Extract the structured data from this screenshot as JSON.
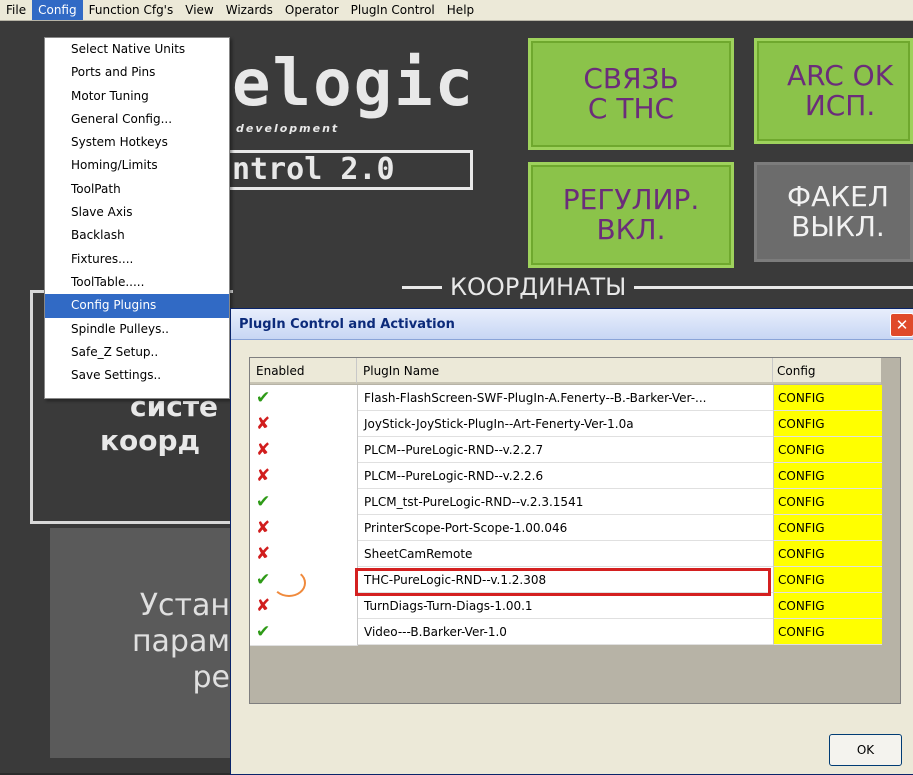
{
  "menubar": {
    "items": [
      "File",
      "Config",
      "Function Cfg's",
      "View",
      "Wizards",
      "Operator",
      "PlugIn Control",
      "Help"
    ]
  },
  "config_menu": {
    "items": [
      "Select Native Units",
      "Ports and Pins",
      "Motor Tuning",
      "General Config...",
      "System Hotkeys",
      "Homing/Limits",
      "ToolPath",
      "Slave Axis",
      "Backlash",
      "Fixtures....",
      "ToolTable.....",
      "Config Plugins",
      "Spindle Pulleys..",
      "Safe_Z Setup..",
      "Save Settings.."
    ],
    "selected": "Config Plugins"
  },
  "background": {
    "logo_text": "elogic",
    "logo_subtext": "development",
    "logo_control": "ntrol 2.0",
    "btn_thc_link": "СВЯЗЬ\nС ТНС",
    "btn_arc_ok": "ARC OK\nИСП.",
    "btn_reg_on": "РЕГУЛИР.\nВКЛ.",
    "btn_torch_off": "ФАКЕЛ\nВЫКЛ.",
    "coords_title": "КООРДИНАТЫ",
    "sys_line1": "систе",
    "sys_line2": "коорд",
    "panel_text": "Устан\nпарам\nре"
  },
  "dialog": {
    "title": "PlugIn Control and Activation",
    "col_enabled": "Enabled",
    "col_name": "PlugIn Name",
    "col_config": "Config",
    "ok_label": "OK",
    "plugins": [
      {
        "enabled": true,
        "name": "Flash-FlashScreen-SWF-PlugIn-A.Fenerty--B.-Barker-Ver-...",
        "config": "CONFIG"
      },
      {
        "enabled": false,
        "name": "JoyStick-JoyStick-PlugIn--Art-Fenerty-Ver-1.0a",
        "config": "CONFIG"
      },
      {
        "enabled": false,
        "name": "PLCM--PureLogic-RND--v.2.2.7",
        "config": "CONFIG"
      },
      {
        "enabled": false,
        "name": "PLCM--PureLogic-RND--v.2.2.6",
        "config": "CONFIG"
      },
      {
        "enabled": true,
        "name": "PLCM_tst-PureLogic-RND--v.2.3.1541",
        "config": "CONFIG"
      },
      {
        "enabled": false,
        "name": "PrinterScope-Port-Scope-1.00.046",
        "config": "CONFIG"
      },
      {
        "enabled": false,
        "name": "SheetCamRemote",
        "config": "CONFIG"
      },
      {
        "enabled": true,
        "name": "THC-PureLogic-RND--v.1.2.308",
        "config": "CONFIG"
      },
      {
        "enabled": false,
        "name": "TurnDiags-Turn-Diags-1.00.1",
        "config": "CONFIG"
      },
      {
        "enabled": true,
        "name": "Video---B.Barker-Ver-1.0",
        "config": "CONFIG"
      }
    ]
  },
  "colors": {
    "config_cell": "#ffff00",
    "enabled_check": "#2e9a17",
    "disabled_x": "#d11d1d",
    "highlight": "#d42020"
  }
}
